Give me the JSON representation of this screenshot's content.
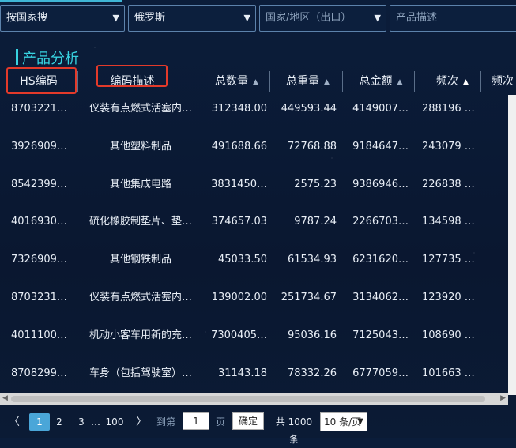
{
  "filters": {
    "search_mode": "按国家搜",
    "country": "俄罗斯",
    "region_placeholder": "国家/地区（出口）",
    "product_placeholder": "产品描述"
  },
  "section_title": "产品分析",
  "columns": {
    "hs": "HS编码",
    "desc": "编码描述",
    "qty": "总数量",
    "weight": "总重量",
    "amount": "总金额",
    "freq": "频次",
    "freq2": "频次"
  },
  "rows": [
    {
      "hs": "8703221…",
      "desc": "仪装有点燃式活塞内…",
      "qty": "312348.00",
      "weight": "449593.44",
      "amount": "4149007…",
      "freq": "288196 …"
    },
    {
      "hs": "3926909…",
      "desc": "其他塑料制品",
      "qty": "491688.66",
      "weight": "72768.88",
      "amount": "9184647…",
      "freq": "243079 …"
    },
    {
      "hs": "8542399…",
      "desc": "其他集成电路",
      "qty": "3831450…",
      "weight": "2575.23",
      "amount": "9386946…",
      "freq": "226838 …"
    },
    {
      "hs": "4016930…",
      "desc": "硫化橡胶制垫片、垫…",
      "qty": "374657.03",
      "weight": "9787.24",
      "amount": "2266703…",
      "freq": "134598 …"
    },
    {
      "hs": "7326909…",
      "desc": "其他钢铁制品",
      "qty": "45033.50",
      "weight": "61534.93",
      "amount": "6231620…",
      "freq": "127735 …"
    },
    {
      "hs": "8703231…",
      "desc": "仪装有点燃式活塞内…",
      "qty": "139002.00",
      "weight": "251734.67",
      "amount": "3134062…",
      "freq": "123920 …"
    },
    {
      "hs": "4011100…",
      "desc": "机动小客车用新的充…",
      "qty": "7300405…",
      "weight": "95036.16",
      "amount": "7125043…",
      "freq": "108690 …"
    },
    {
      "hs": "8708299…",
      "desc": "车身（包括驾驶室）…",
      "qty": "31143.18",
      "weight": "78332.26",
      "amount": "6777059…",
      "freq": "101663 …"
    }
  ],
  "pagination": {
    "prev": "〈",
    "next": "〉",
    "page1": "1",
    "page2": "2",
    "page3": "3",
    "ellipsis": "…",
    "last": "100",
    "goto_label": "到第",
    "goto_value": "1",
    "page_unit": "页",
    "confirm": "确定",
    "total": "共 1000 条",
    "page_size": "10 条/页"
  }
}
